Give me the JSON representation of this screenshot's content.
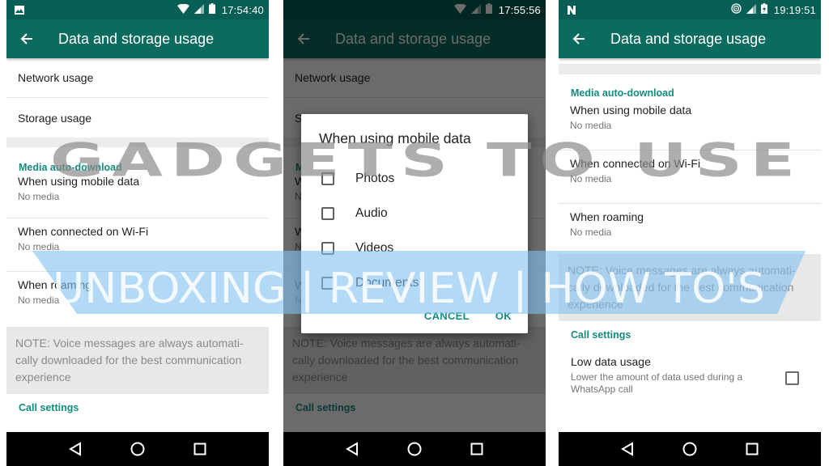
{
  "colors": {
    "status_bar": "#075e54",
    "app_bar": "#0a6b5e",
    "accent": "#128c7e",
    "note_bg": "#e8e8e8",
    "nav_bar": "#000000"
  },
  "phones": [
    {
      "status": {
        "left_icon": "image-notification-icon",
        "icons": [
          "wifi-icon",
          "signal-icon",
          "battery-icon"
        ],
        "time": "17:54:40"
      },
      "appbar": {
        "back_icon": "arrow-back-icon",
        "title": "Data and storage usage"
      },
      "items": [
        "Network usage",
        "Storage usage"
      ],
      "media_section": "Media auto-download",
      "media_items": [
        {
          "label": "When using mobile data",
          "value": "No media"
        },
        {
          "label": "When connected on Wi-Fi",
          "value": "No media"
        },
        {
          "label": "When roaming",
          "value": "No media"
        }
      ],
      "note": "NOTE: Voice messages are always automati-cally downloaded for the best communication experience",
      "call_section": "Call settings"
    },
    {
      "status": {
        "icons": [
          "wifi-icon",
          "signal-icon",
          "battery-icon"
        ],
        "time": "17:55:56"
      },
      "appbar": {
        "back_icon": "arrow-back-icon",
        "title": "Data and storage usage"
      },
      "items": [
        "Network usage",
        "Storage usage"
      ],
      "media_section": "Media auto-download",
      "media_items": [
        {
          "label": "When using mobile data",
          "value": "No media"
        },
        {
          "label": "When connected on Wi-Fi",
          "value": "No media"
        },
        {
          "label": "When roaming",
          "value": "No media"
        }
      ],
      "note": "NOTE: Voice messages are always automati-cally downloaded for the best communication experience",
      "call_section": "Call settings",
      "dialog": {
        "title": "When using mobile data",
        "options": [
          {
            "label": "Photos",
            "checked": false
          },
          {
            "label": "Audio",
            "checked": false
          },
          {
            "label": "Videos",
            "checked": false
          },
          {
            "label": "Documents",
            "checked": false
          }
        ],
        "cancel": "CANCEL",
        "ok": "OK"
      }
    },
    {
      "status": {
        "left_icon": "n-notification-icon",
        "icons": [
          "hotspot-icon",
          "signal-icon",
          "battery-charging-icon"
        ],
        "time": "19:19:51"
      },
      "appbar": {
        "back_icon": "arrow-back-icon",
        "title": "Data and storage usage"
      },
      "media_section": "Media auto-download",
      "media_items": [
        {
          "label": "When using mobile data",
          "value": "No media"
        },
        {
          "label": "When connected on Wi-Fi",
          "value": "No media"
        },
        {
          "label": "When roaming",
          "value": "No media"
        }
      ],
      "note": "NOTE: Voice messages are always automati-cally downloaded for the best communication experience",
      "call_section": "Call settings",
      "low_data": {
        "label": "Low data usage",
        "description": "Lower the amount of data used during a WhatsApp call",
        "checked": false
      }
    }
  ],
  "navbar": {
    "back": "nav-back-icon",
    "home": "nav-home-icon",
    "recents": "nav-recents-icon"
  },
  "watermark": {
    "line1": "GADGETS TO USE",
    "line2": "UNBOXING | REVIEW | HOW TO'S"
  }
}
